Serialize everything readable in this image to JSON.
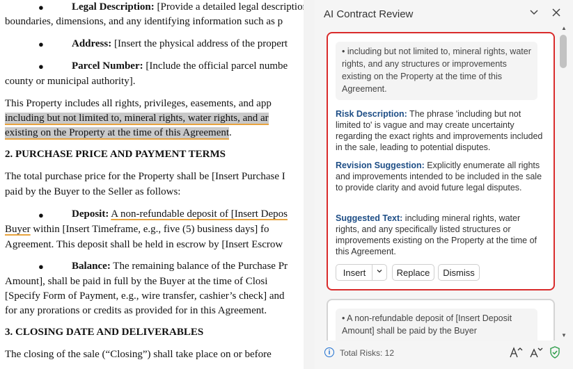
{
  "document": {
    "legal_desc_label": "Legal Description:",
    "legal_desc_text": " [Provide a detailed legal description",
    "legal_desc_cont": "boundaries, dimensions, and any identifying information such as p",
    "address_label": "Address:",
    "address_text": " [Insert the physical address of the propert",
    "parcel_label": "Parcel Number:",
    "parcel_text": " [Include the official parcel numbe",
    "parcel_cont": "county or municipal authority].",
    "para1_line1": "This Property includes all rights, privileges, easements, and app",
    "para1_line2": "including but not limited to, mineral rights, water rights, and ar",
    "para1_line3": "existing on the Property at the time of this Agreement",
    "para1_period": ".",
    "heading2": "2. PURCHASE PRICE AND PAYMENT TERMS",
    "para2_line1": "The total purchase price for the Property shall be [Insert Purchase I",
    "para2_line2": "paid by the Buyer to the Seller as follows:",
    "deposit_label": "Deposit:",
    "deposit_text": "A non-refundable deposit of [Insert Depos",
    "deposit_cont_ul": "Buyer",
    "deposit_cont": " within [Insert Timeframe, e.g., five (5) business days] fo",
    "deposit_cont2": "Agreement. This deposit shall be held in escrow by [Insert Escrow",
    "balance_label": "Balance:",
    "balance_text": " The remaining balance of the Purchase Pr",
    "balance_cont1": "Amount], shall be paid in full by the Buyer at the time of Closi",
    "balance_cont2": "[Specify Form of Payment, e.g., wire transfer, cashier’s check] and",
    "balance_cont3": "for any prorations or credits as provided for in this Agreement.",
    "heading3": "3. CLOSING DATE AND DELIVERABLES",
    "para3_line1": "The closing of the sale (“Closing”) shall take place on or before"
  },
  "panel": {
    "title": "AI Contract Review",
    "card1": {
      "quote": "• including but not limited to, mineral rights, water rights, and any structures or improvements existing on the Property at the time of this Agreement.",
      "risk_label": "Risk Description:",
      "risk_text": " The phrase 'including but not limited to' is vague and may create uncertainty regarding the exact rights and improvements included in the sale, leading to potential disputes.",
      "revision_label": "Revision Suggestion:",
      "revision_text": " Explicitly enumerate all rights and improvements intended to be included in the sale to provide clarity and avoid future legal disputes.",
      "suggested_label": "Suggested Text:",
      "suggested_text": " including mineral rights, water rights, and any specifically listed structures or improvements existing on the Property at the time of this Agreement.",
      "insert_label": "Insert",
      "replace_label": "Replace",
      "dismiss_label": "Dismiss"
    },
    "card2": {
      "quote": "• A non-refundable deposit of [Insert Deposit Amount] shall be paid by the Buyer"
    },
    "footer": {
      "total_risks": "Total Risks: 12"
    }
  },
  "icons": {
    "chevron": "chevron-down-icon",
    "close": "close-icon",
    "info": "info-icon",
    "increase_font": "font-increase-icon",
    "decrease_font": "font-decrease-icon",
    "shield": "shield-check-icon"
  },
  "colors": {
    "risk_border": "#d92b2b",
    "label_blue": "#1e4e86",
    "highlight_underline": "#e8a33d",
    "shield_green": "#2e9d4a"
  }
}
